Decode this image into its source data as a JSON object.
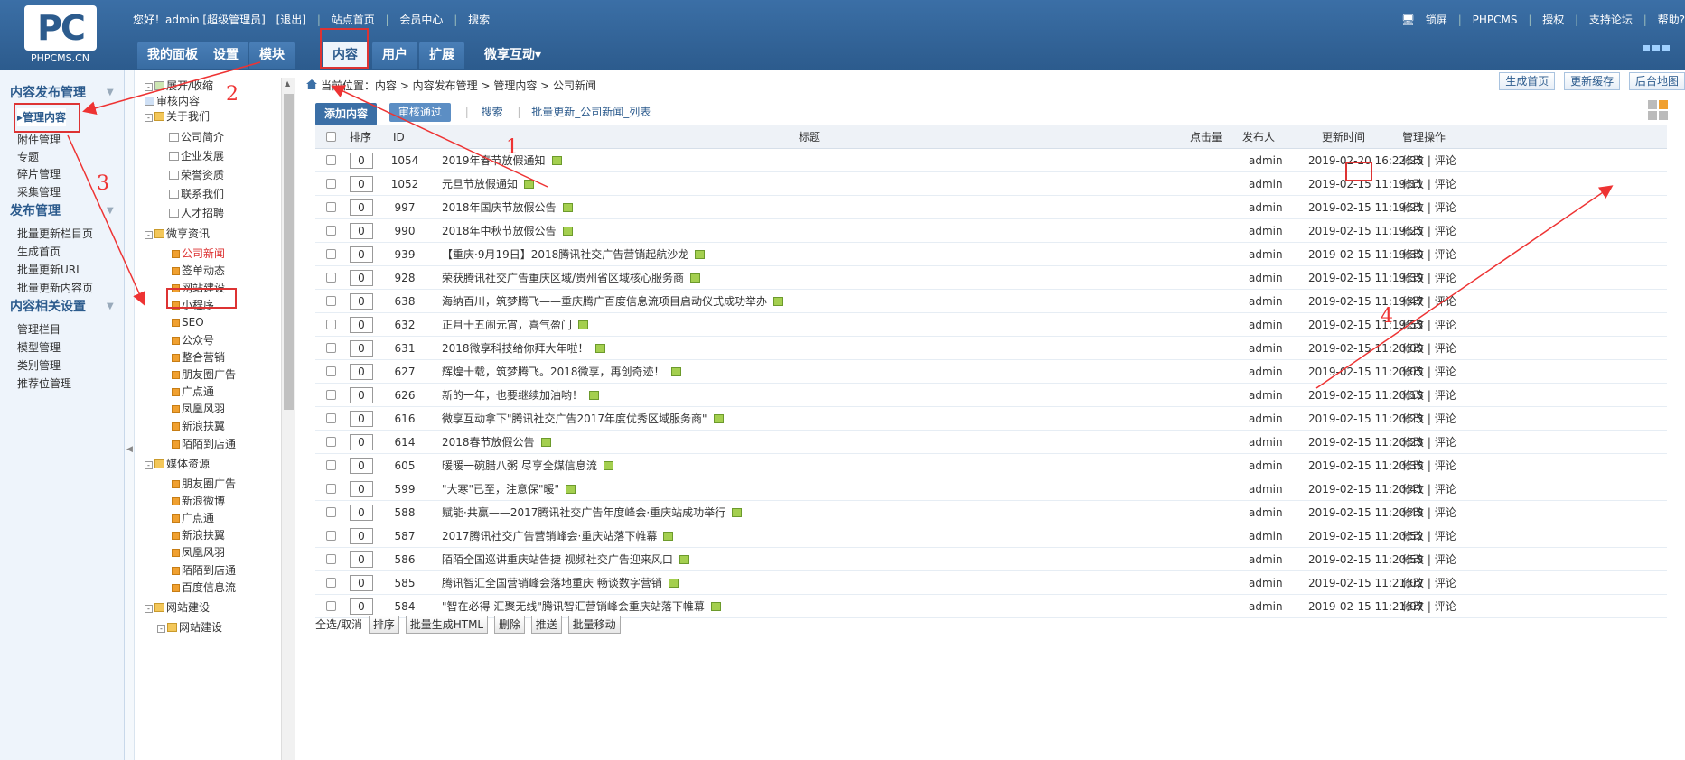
{
  "header": {
    "logo_text": "PC",
    "logo_sub": "PHPCMS.CN",
    "greeting": "您好！admin [超级管理员]",
    "logout": "[退出]",
    "site_home": "站点首页",
    "member_center": "会员中心",
    "search": "搜索",
    "right_links": [
      "锁屏",
      "PHPCMS",
      "授权",
      "支持论坛",
      "帮助?"
    ],
    "nav": [
      "我的面板",
      "设置",
      "模块",
      "内容",
      "用户",
      "扩展",
      "微享互动▾"
    ],
    "active_nav": "内容"
  },
  "sidebar": {
    "sections": [
      {
        "title": "内容发布管理",
        "items": [
          "▸管理内容",
          "附件管理",
          "专题",
          "碎片管理",
          "采集管理"
        ]
      },
      {
        "title": "发布管理",
        "items": [
          "批量更新栏目页",
          "生成首页",
          "批量更新URL",
          "批量更新内容页"
        ]
      },
      {
        "title": "内容相关设置",
        "items": [
          "管理栏目",
          "模型管理",
          "类别管理",
          "推荐位管理"
        ]
      }
    ]
  },
  "tree": [
    "展开/收缩",
    "审核内容",
    "关于我们",
    "公司简介",
    "企业发展",
    "荣誉资质",
    "联系我们",
    "人才招聘",
    "微享资讯",
    "公司新闻",
    "签单动态",
    "网站建设",
    "小程序",
    "SEO",
    "公众号",
    "整合营销",
    "朋友圈广告",
    "广点通",
    "凤凰风羽",
    "新浪扶翼",
    "陌陌到店通",
    "媒体资源",
    "朋友圈广告",
    "新浪微博",
    "广点通",
    "新浪扶翼",
    "凤凰风羽",
    "陌陌到店通",
    "百度信息流",
    "网站建设",
    "网站建设"
  ],
  "main": {
    "breadcrumb": "当前位置：内容 > 内容发布管理 > 管理内容 > 公司新闻",
    "crumb_buttons": [
      "生成首页",
      "更新缓存",
      "后台地图"
    ],
    "toolbar": {
      "add": "添加内容",
      "audit": "审核通过",
      "search": "搜索",
      "batch": "批量更新_公司新闻_列表"
    },
    "columns": {
      "order": "排序",
      "id": "ID",
      "title": "标题",
      "hits": "点击量",
      "author": "发布人",
      "time": "更新时间",
      "ops": "管理操作"
    },
    "rows": [
      {
        "order": "0",
        "id": "1054",
        "title": "2019年春节放假通知",
        "author": "admin",
        "time": "2019-02-20 16:22:25"
      },
      {
        "order": "0",
        "id": "1052",
        "title": "元旦节放假通知",
        "author": "admin",
        "time": "2019-02-15 11:19:11"
      },
      {
        "order": "0",
        "id": "997",
        "title": "2018年国庆节放假公告",
        "author": "admin",
        "time": "2019-02-15 11:19:21"
      },
      {
        "order": "0",
        "id": "990",
        "title": "2018年中秋节放假公告",
        "author": "admin",
        "time": "2019-02-15 11:19:25"
      },
      {
        "order": "0",
        "id": "939",
        "title": "【重庆·9月19日】2018腾讯社交广告营销起航沙龙",
        "author": "admin",
        "time": "2019-02-15 11:19:30"
      },
      {
        "order": "0",
        "id": "928",
        "title": "荣获腾讯社交广告重庆区域/贵州省区域核心服务商",
        "author": "admin",
        "time": "2019-02-15 11:19:39"
      },
      {
        "order": "0",
        "id": "638",
        "title": "海纳百川，筑梦腾飞——重庆腾广百度信息流项目启动仪式成功举办",
        "author": "admin",
        "time": "2019-02-15 11:19:47"
      },
      {
        "order": "0",
        "id": "632",
        "title": "正月十五闹元宵，喜气盈门",
        "author": "admin",
        "time": "2019-02-15 11:19:53"
      },
      {
        "order": "0",
        "id": "631",
        "title": "2018微享科技给你拜大年啦！",
        "author": "admin",
        "time": "2019-02-15 11:20:00"
      },
      {
        "order": "0",
        "id": "627",
        "title": "辉煌十载，筑梦腾飞。2018微享，再创奇迹！",
        "author": "admin",
        "time": "2019-02-15 11:20:05"
      },
      {
        "order": "0",
        "id": "626",
        "title": "新的一年，也要继续加油哟！",
        "author": "admin",
        "time": "2019-02-15 11:20:18"
      },
      {
        "order": "0",
        "id": "616",
        "title": "微享互动拿下\"腾讯社交广告2017年度优秀区域服务商\"",
        "author": "admin",
        "time": "2019-02-15 11:20:23"
      },
      {
        "order": "0",
        "id": "614",
        "title": "2018春节放假公告",
        "author": "admin",
        "time": "2019-02-15 11:20:28"
      },
      {
        "order": "0",
        "id": "605",
        "title": "暖暖一碗腊八粥 尽享全媒信息流",
        "author": "admin",
        "time": "2019-02-15 11:20:36"
      },
      {
        "order": "0",
        "id": "599",
        "title": "\"大寒\"已至，注意保\"暖\"",
        "author": "admin",
        "time": "2019-02-15 11:20:41"
      },
      {
        "order": "0",
        "id": "588",
        "title": "赋能·共赢——2017腾讯社交广告年度峰会·重庆站成功举行",
        "author": "admin",
        "time": "2019-02-15 11:20:48"
      },
      {
        "order": "0",
        "id": "587",
        "title": "2017腾讯社交广告营销峰会·重庆站落下帷幕",
        "author": "admin",
        "time": "2019-02-15 11:20:52"
      },
      {
        "order": "0",
        "id": "586",
        "title": "陌陌全国巡讲重庆站告捷 视频社交广告迎来风口",
        "author": "admin",
        "time": "2019-02-15 11:20:58"
      },
      {
        "order": "0",
        "id": "585",
        "title": "腾讯智汇全国营销峰会落地重庆 畅谈数字营销",
        "author": "admin",
        "time": "2019-02-15 11:21:02"
      },
      {
        "order": "0",
        "id": "584",
        "title": "\"智在必得 汇聚无线\"腾讯智汇营销峰会重庆站落下帷幕",
        "author": "admin",
        "time": "2019-02-15 11:21:07"
      }
    ],
    "op_edit": "修改",
    "op_sep": "|",
    "op_comment": "评论",
    "footer": {
      "select_all": "全选/取消",
      "buttons": [
        "排序",
        "批量生成HTML",
        "删除",
        "推送",
        "批量移动"
      ]
    }
  },
  "annotations": [
    "1",
    "2",
    "3",
    "4"
  ],
  "colors": {
    "header": "#2c5b8d",
    "highlight": "#dd3333",
    "link": "#2c5b8d"
  }
}
